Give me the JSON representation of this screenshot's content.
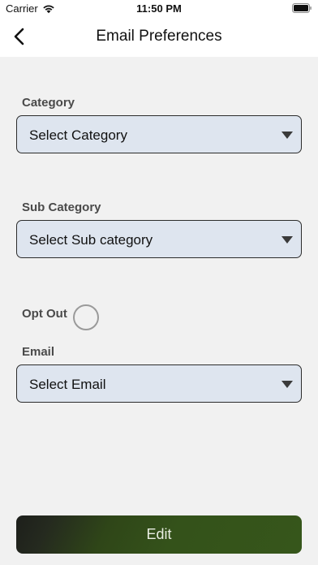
{
  "status_bar": {
    "carrier": "Carrier",
    "time": "11:50 PM"
  },
  "header": {
    "title": "Email Preferences",
    "back_icon": "chevron-left-icon"
  },
  "form": {
    "category": {
      "label": "Category",
      "value": "Select Category"
    },
    "sub_category": {
      "label": "Sub Category",
      "value": "Select Sub category"
    },
    "opt_out": {
      "label": "Opt Out",
      "checked": false
    },
    "email": {
      "label": "Email",
      "value": "Select Email"
    }
  },
  "actions": {
    "edit_label": "Edit"
  },
  "colors": {
    "background": "#f1f1f1",
    "select_fill": "#dee5ef",
    "button_green": "#36561b"
  }
}
